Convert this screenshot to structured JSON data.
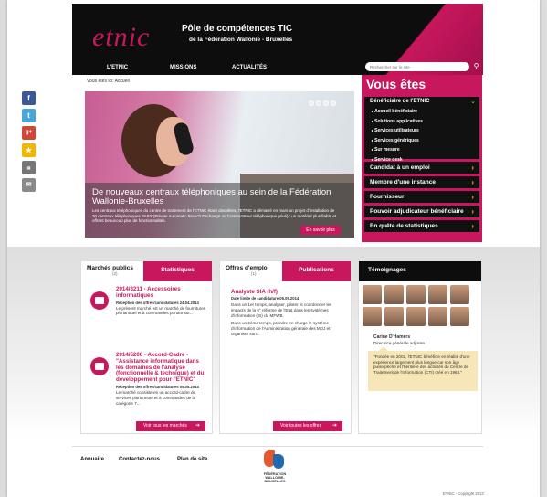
{
  "header": {
    "logo": "etnic",
    "tagline1": "Pôle de compétences TIC",
    "tagline2": "de la Fédération Wallonie - Bruxelles",
    "nav": [
      "L'ETNIC",
      "MISSIONS",
      "ACTUALITÉS"
    ],
    "search_placeholder": "Rechercher sur le site",
    "search_icon": "search-icon"
  },
  "social": [
    "f",
    "t",
    "g+",
    "★",
    "print",
    "mail"
  ],
  "breadcrumb": "Vous êtes ici: Accueil",
  "slider": {
    "title": "De nouveaux centraux téléphoniques au sein de la Fédération Wallonie-Bruxelles",
    "text": "Les centraux téléphoniques du centre de traitement de l'ETNIC étant obsolètes, l'ETNIC a démarré en mars un projet d'installation de 30 centraux téléphoniques PABX (Private Automatic Branch Exchange ou Commutateur téléphonique privé) : un matériel plus fiable et offrant beaucoup plus de fonctionnalités.",
    "more": "En savoir plus",
    "dots": 4
  },
  "vous": {
    "title": "Vous êtes",
    "beneficiaire": {
      "title": "Bénéficiaire de l'ETNIC",
      "items": [
        "Accueil bénéficiaire",
        "Solutions applicatives",
        "Services utilisateurs",
        "Services génériques",
        "Sur mesure",
        "Service desk"
      ]
    },
    "items": [
      "Candidat à un emploi",
      "Membre d'une instance",
      "Fournisseur",
      "Pouvoir adjudicateur bénéficiaire",
      "En quête de statistiques"
    ]
  },
  "marches": {
    "tab": "Marchés publics",
    "count": "(2)",
    "tab2": "Statistiques",
    "entries": [
      {
        "title": "2014/3211 - Accessoires informatiques",
        "date": "Réception des offres/candidatures 24.04.2014",
        "text": "Le présent marché est un marché de fournitures pluriannuel et à commandes portant sur..."
      },
      {
        "title": "2014/5200 - Accord-Cadre - \"Assistance informatique dans les domaines de l'analyse (fonctionnelle & technique) et du développement pour l'ETNIC\"",
        "date": "Réception des offres/candidatures 05.05.2014",
        "text": "Le marché consiste en un accord-cadre de services pluriannuel et à commandes de la catégorie 7..."
      }
    ],
    "button": "Voir tous les marchés"
  },
  "offres": {
    "tab": "Offres d'emploi",
    "count": "(1)",
    "tab2": "Publications",
    "title": "Analyste SIA (h/f)",
    "date": "Date limite de candidature 05.05.2014",
    "text1": "Dans un 1er temps, analyser, piloter et coordonner les impacts de la 6° réforme de l'Etat dans les systèmes d'information (SI) du MFWB.",
    "text2": "Dans un 2ème temps, prendre en charge le système d'information de l'Administration générale des MDJ et organiser son...",
    "button": "Voir toutes les offres"
  },
  "temoignages": {
    "title": "Témoignages",
    "name": "Carine D'Hamers",
    "role": "Directrice générale adjointe",
    "quote": "\"Fondée en 2002, l'ETNIC bénéficie en réalité d'une expérience largement plus longue car son âge puise/pêche et l'héritière des activités du Centre de Traitement de l'Information (CTI) créé en 1964.\""
  },
  "footer": {
    "links": [
      "Annuaire",
      "Contactez-nous",
      "Plan de site"
    ],
    "logo_text": "FÉDÉRATION WALLONIE-BRUXELLES",
    "copyright": "ETNIC - Copyright 2013"
  },
  "colors": {
    "accent": "#c8175d",
    "dark": "#0d0d0d",
    "arrow": "#f0c000"
  }
}
